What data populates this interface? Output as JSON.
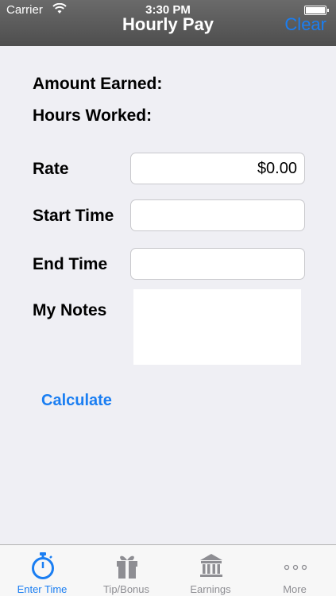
{
  "status_bar": {
    "carrier": "Carrier",
    "time": "3:30 PM"
  },
  "nav": {
    "title": "Hourly Pay",
    "clear_label": "Clear"
  },
  "summary": {
    "amount_earned_label": "Amount Earned:",
    "hours_worked_label": "Hours Worked:"
  },
  "form": {
    "rate_label": "Rate",
    "rate_value": "$0.00",
    "start_time_label": "Start Time",
    "start_time_value": "",
    "end_time_label": "End Time",
    "end_time_value": "",
    "notes_label": "My Notes",
    "notes_value": ""
  },
  "actions": {
    "calculate_label": "Calculate"
  },
  "tabbar": {
    "active_color": "#1a7ef2",
    "inactive_color": "#8e8e93",
    "tabs": [
      {
        "label": "Enter Time",
        "icon": "stopwatch-icon",
        "active": true
      },
      {
        "label": "Tip/Bonus",
        "icon": "gift-icon",
        "active": false
      },
      {
        "label": "Earnings",
        "icon": "bank-icon",
        "active": false
      },
      {
        "label": "More",
        "icon": "more-icon",
        "active": false
      }
    ]
  },
  "colors": {
    "accent": "#1a7ef2",
    "navbar": "#5a5a5a",
    "background": "#efeff4"
  }
}
